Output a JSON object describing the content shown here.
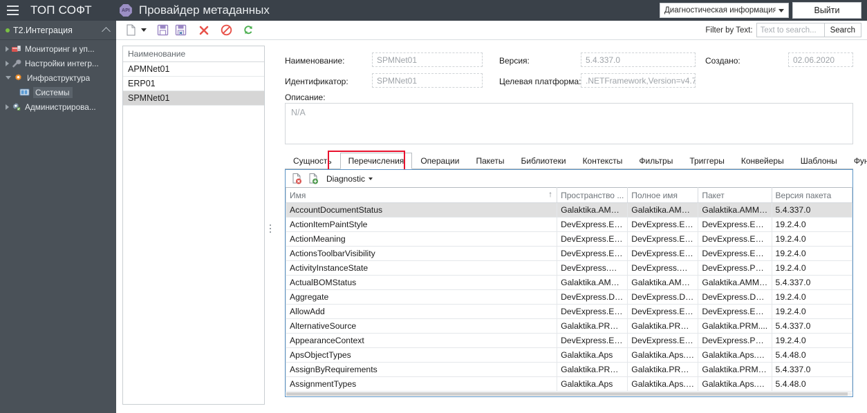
{
  "header": {
    "brand": "ТОП СОФТ",
    "api_icon_text": "API",
    "subtitle": "Провайдер метаданных",
    "diagnostic_select": "Диагностическая информация",
    "exit_button": "Выйти"
  },
  "toolbar": {
    "icons": [
      "new-document-icon",
      "save-icon",
      "save-as-icon",
      "delete-icon",
      "cancel-icon",
      "refresh-icon"
    ],
    "filter_label": "Filter by Text:",
    "filter_placeholder": "Text to search...",
    "filter_value": "",
    "search_button": "Search"
  },
  "sidebar": {
    "root": "T2.Интеграция",
    "items": [
      {
        "label": "Мониторинг и уп...",
        "icon": "monitoring-icon",
        "expandable": true,
        "selected": false
      },
      {
        "label": "Настройки интегр...",
        "icon": "wrench-icon",
        "expandable": true,
        "selected": false
      },
      {
        "label": "Инфраструктура",
        "icon": "gear-icon",
        "expandable": true,
        "expanded": true,
        "selected": false
      },
      {
        "label": "Системы",
        "icon": "monitor-icon",
        "child": true,
        "selected": true
      },
      {
        "label": "Администрирова...",
        "icon": "admin-gear-icon",
        "expandable": true,
        "selected": false
      }
    ]
  },
  "list_panel": {
    "header": "Наименование",
    "rows": [
      {
        "name": "APMNet01",
        "selected": false
      },
      {
        "name": "ERP01",
        "selected": false
      },
      {
        "name": "SPMNet01",
        "selected": true
      }
    ]
  },
  "form": {
    "name_label": "Наименование:",
    "name_value": "SPMNet01",
    "identifier_label": "Идентификатор:",
    "identifier_value": "SPMNet01",
    "version_label": "Версия:",
    "version_value": "5.4.337.0",
    "platform_label": "Целевая платформа:",
    "platform_value": ".NETFramework,Version=v4.7",
    "created_label": "Создано:",
    "created_value": "02.06.2020",
    "description_label": "Описание:",
    "description_value": "N/A"
  },
  "tabs": {
    "items": [
      "Сущность",
      "Перечисления",
      "Операции",
      "Пакеты",
      "Библиотеки",
      "Контексты",
      "Фильтры",
      "Триггеры",
      "Конвейеры",
      "Шаблоны",
      "Функции"
    ],
    "active": "Перечисления",
    "highlight_color": "#e8112d"
  },
  "grid_toolbar": {
    "icons": [
      "document-remove-icon",
      "document-add-icon"
    ],
    "dropdown_label": "Diagnostic"
  },
  "grid": {
    "columns": [
      "Имя",
      "Пространство ...",
      "Полное имя",
      "Пакет",
      "Версия пакета"
    ],
    "sort_column": "Имя",
    "sort_direction": "asc",
    "rows": [
      {
        "selected": true,
        "cells": [
          "AccountDocumentStatus",
          "Galaktika.AMM....",
          "Galaktika.AMM....",
          "Galaktika.AMM....",
          "5.4.337.0"
        ]
      },
      {
        "selected": false,
        "cells": [
          "ActionItemPaintStyle",
          "DevExpress.Expr...",
          "DevExpress.Expr...",
          "DevExpress.Expr...",
          "19.2.4.0"
        ]
      },
      {
        "selected": false,
        "cells": [
          "ActionMeaning",
          "DevExpress.Expr...",
          "DevExpress.Expr...",
          "DevExpress.Expr...",
          "19.2.4.0"
        ]
      },
      {
        "selected": false,
        "cells": [
          "ActionsToolbarVisibility",
          "DevExpress.Expr...",
          "DevExpress.Expr...",
          "DevExpress.Expr...",
          "19.2.4.0"
        ]
      },
      {
        "selected": false,
        "cells": [
          "ActivityInstanceState",
          "DevExpress.Wor...",
          "DevExpress.Wor...",
          "DevExpress.Pers...",
          "19.2.4.0"
        ]
      },
      {
        "selected": false,
        "cells": [
          "ActualBOMStatus",
          "Galaktika.AMM....",
          "Galaktika.AMM....",
          "Galaktika.AMM....",
          "5.4.337.0"
        ]
      },
      {
        "selected": false,
        "cells": [
          "Aggregate",
          "DevExpress.Dat...",
          "DevExpress.Dat...",
          "DevExpress.Dat...",
          "19.2.4.0"
        ]
      },
      {
        "selected": false,
        "cells": [
          "AllowAdd",
          "DevExpress.Expr...",
          "DevExpress.Expr...",
          "DevExpress.Expr...",
          "19.2.4.0"
        ]
      },
      {
        "selected": false,
        "cells": [
          "AlternativeSource",
          "Galaktika.PRM....",
          "Galaktika.PRM....",
          "Galaktika.PRM....",
          "5.4.337.0"
        ]
      },
      {
        "selected": false,
        "cells": [
          "AppearanceContext",
          "DevExpress.Expr...",
          "DevExpress.Expr...",
          "DevExpress.Pers...",
          "19.2.4.0"
        ]
      },
      {
        "selected": false,
        "cells": [
          "ApsObjectTypes",
          "Galaktika.Aps",
          "Galaktika.Aps.A...",
          "Galaktika.Aps.C...",
          "5.4.48.0"
        ]
      },
      {
        "selected": false,
        "cells": [
          "AssignByRequirements",
          "Galaktika.PRM.A...",
          "Galaktika.PRM.A...",
          "Galaktika.PRM.A...",
          "5.4.337.0"
        ]
      },
      {
        "selected": false,
        "cells": [
          "AssignmentTypes",
          "Galaktika.Aps",
          "Galaktika.Aps.A...",
          "Galaktika.Aps.C...",
          "5.4.48.0"
        ]
      }
    ]
  }
}
